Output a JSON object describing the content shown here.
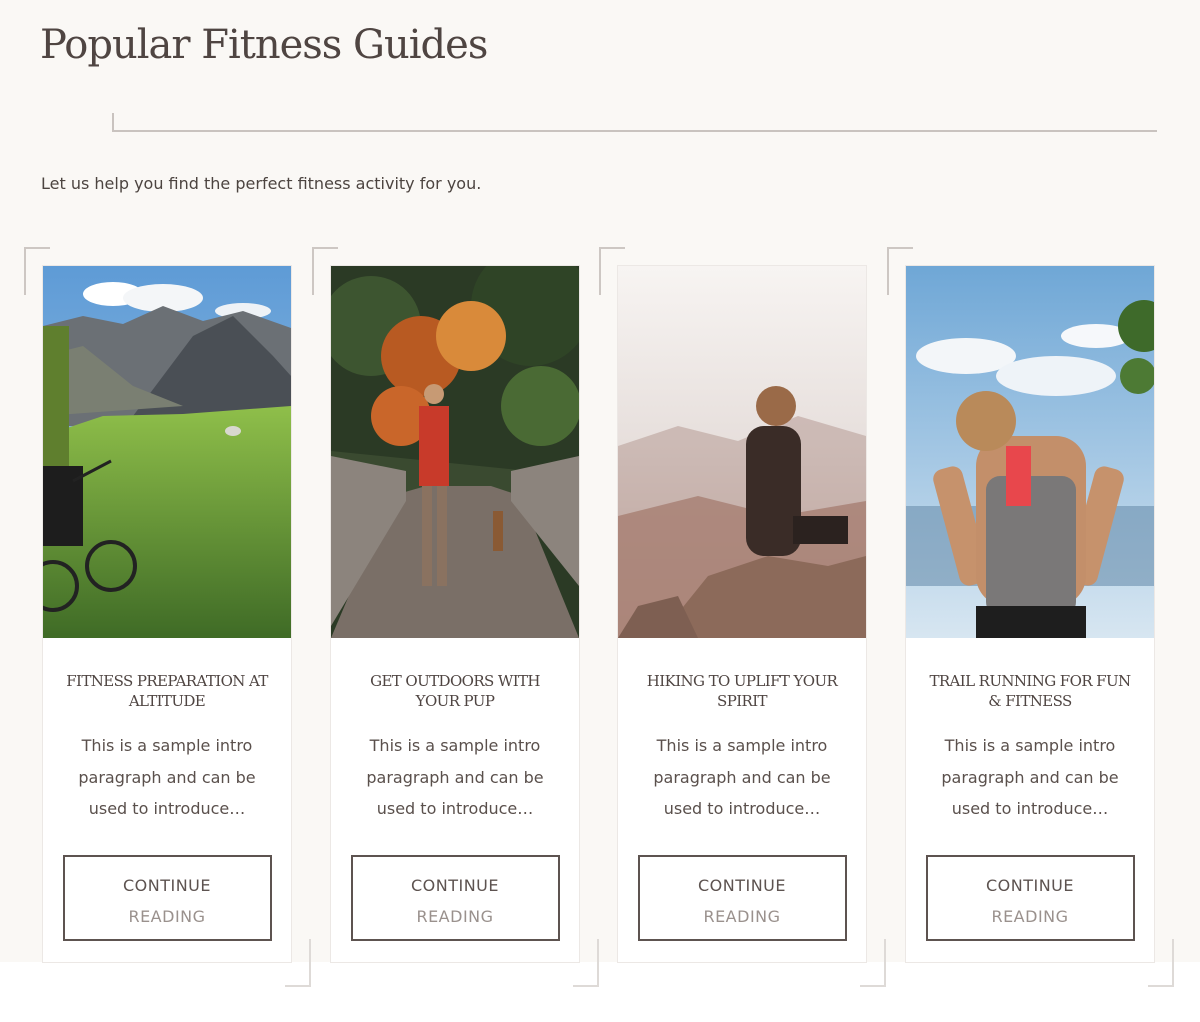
{
  "page": {
    "title": "Popular Fitness Guides",
    "intro": "Let us help you find the perfect fitness activity for you."
  },
  "cards": [
    {
      "title": "FITNESS PREPARATION AT ALTITUDE",
      "excerpt": "This is a sample intro paragraph and can be used to introduce…",
      "button_line1": "CONTINUE",
      "button_line2": "READING",
      "image": "mountain-biker-alpine-meadow"
    },
    {
      "title": "GET OUTDOORS WITH YOUR PUP",
      "excerpt": "This is a sample intro paragraph and can be used to introduce…",
      "button_line1": "CONTINUE",
      "button_line2": "READING",
      "image": "man-and-dog-on-forest-boardwalk"
    },
    {
      "title": "HIKING TO UPLIFT YOUR SPIRIT",
      "excerpt": "This is a sample intro paragraph and can be used to introduce…",
      "button_line1": "CONTINUE",
      "button_line2": "READING",
      "image": "woman-sitting-on-rock-overlook"
    },
    {
      "title": "TRAIL RUNNING FOR FUN & FITNESS",
      "excerpt": "This is a sample intro paragraph and can be used to introduce…",
      "button_line1": "CONTINUE",
      "button_line2": "READING",
      "image": "runner-woman-hands-on-hips"
    }
  ],
  "colors": {
    "background": "#faf8f5",
    "text": "#4f4542",
    "button_border": "#5d5350"
  }
}
